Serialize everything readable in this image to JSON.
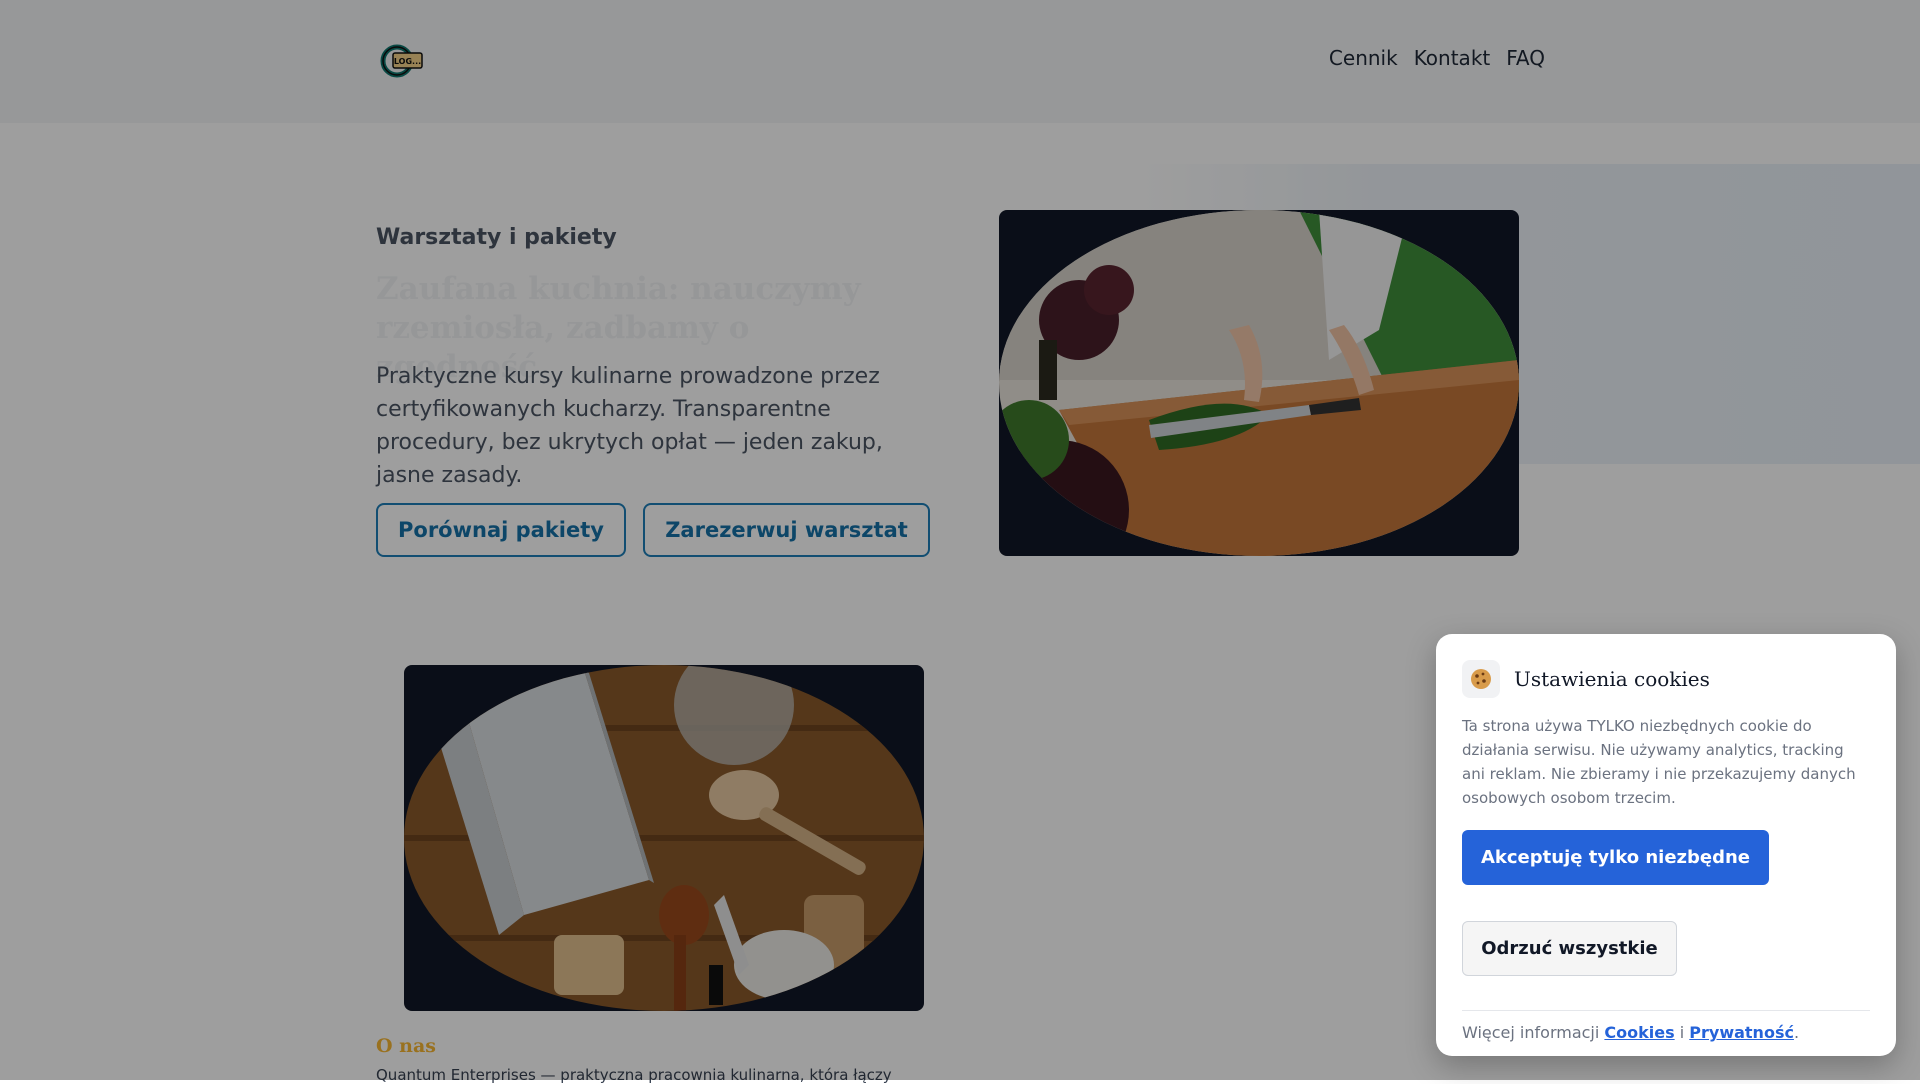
{
  "header": {
    "logo_text": "LOG...",
    "nav": [
      "Cennik",
      "Kontakt",
      "FAQ"
    ]
  },
  "hero": {
    "eyebrow": "Warsztaty i pakiety",
    "title": "Zaufana kuchnia: nauczymy rzemiosła, zadbamy o zgodność",
    "lead": "Praktyczne kursy kulinarne prowadzone przez certyfikowanych kucharzy. Transparentne procedury, bez ukrytych opłat — jeden zakup, jasne zasady.",
    "btn_compare": "Porównaj pakiety",
    "btn_book": "Zarezerwuj warsztat"
  },
  "about": {
    "title": "O nas",
    "text": "Quantum Enterprises — praktyczna pracownia kulinarna, która łączy"
  },
  "cookie": {
    "title": "Ustawienia cookies",
    "text": "Ta strona używa TYLKO niezbędnych cookie do działania serwisu. Nie używamy analytics, tracking ani reklam. Nie zbieramy i nie przekazujemy danych osobowych osobom trzecim.",
    "accept": "Akceptuję tylko niezbędne",
    "reject": "Odrzuć wszystkie",
    "more_prefix": "Więcej informacji",
    "link_cookies": "Cookies",
    "and": "i",
    "link_privacy": "Prywatność",
    "suffix": "."
  },
  "colors": {
    "accent": "#2563d9",
    "outline": "#1d7fb8",
    "about_title": "#f7b733"
  }
}
